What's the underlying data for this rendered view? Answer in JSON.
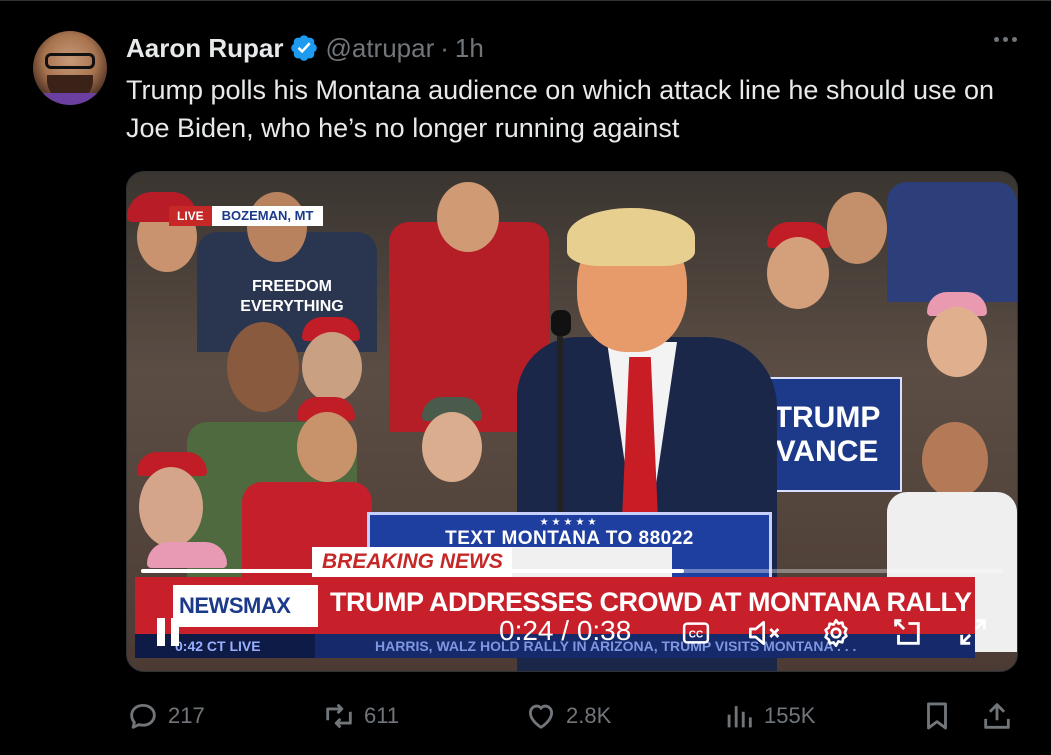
{
  "author": {
    "name": "Aaron Rupar",
    "handle": "@atrupar",
    "separator": "·",
    "time": "1h",
    "verified": true
  },
  "tweet": {
    "text": "Trump polls his Montana audience on which attack line he should use on Joe Biden, who he’s no longer running against"
  },
  "video": {
    "location_live": "LIVE",
    "location_city": "BOZEMAN, MT",
    "podium_stars": "★★★★★",
    "podium_text": "TEXT MONTANA TO 88022",
    "podium_word": "RUMP",
    "crowd_shirt": "FREEDOM EVERYTHING",
    "sign_text": "TRUMP VANCE",
    "breaking": "BREAKING NEWS",
    "network": "NEWSMAX",
    "headline": "TRUMP ADDRESSES CROWD AT MONTANA RALLY",
    "clock": "0:42 CT   LIVE",
    "ticker": "HARRIS, WALZ HOLD RALLY IN ARIZONA, TRUMP VISITS MONTANA . . .",
    "timecode": "0:24 / 0:38",
    "progress": 0.63,
    "icons": [
      "pause-icon",
      "captions-icon",
      "mute-icon",
      "settings-icon",
      "pip-icon",
      "fullscreen-icon"
    ]
  },
  "metrics": {
    "replies": "217",
    "reposts": "611",
    "likes": "2.8K",
    "views": "155K"
  },
  "colors": {
    "background": "#000000",
    "text": "#e7e9ea",
    "muted": "#71767b",
    "verified": "#1d9bf0",
    "newsmax_red": "#c8202b",
    "newsmax_blue": "#1c3a8a"
  }
}
